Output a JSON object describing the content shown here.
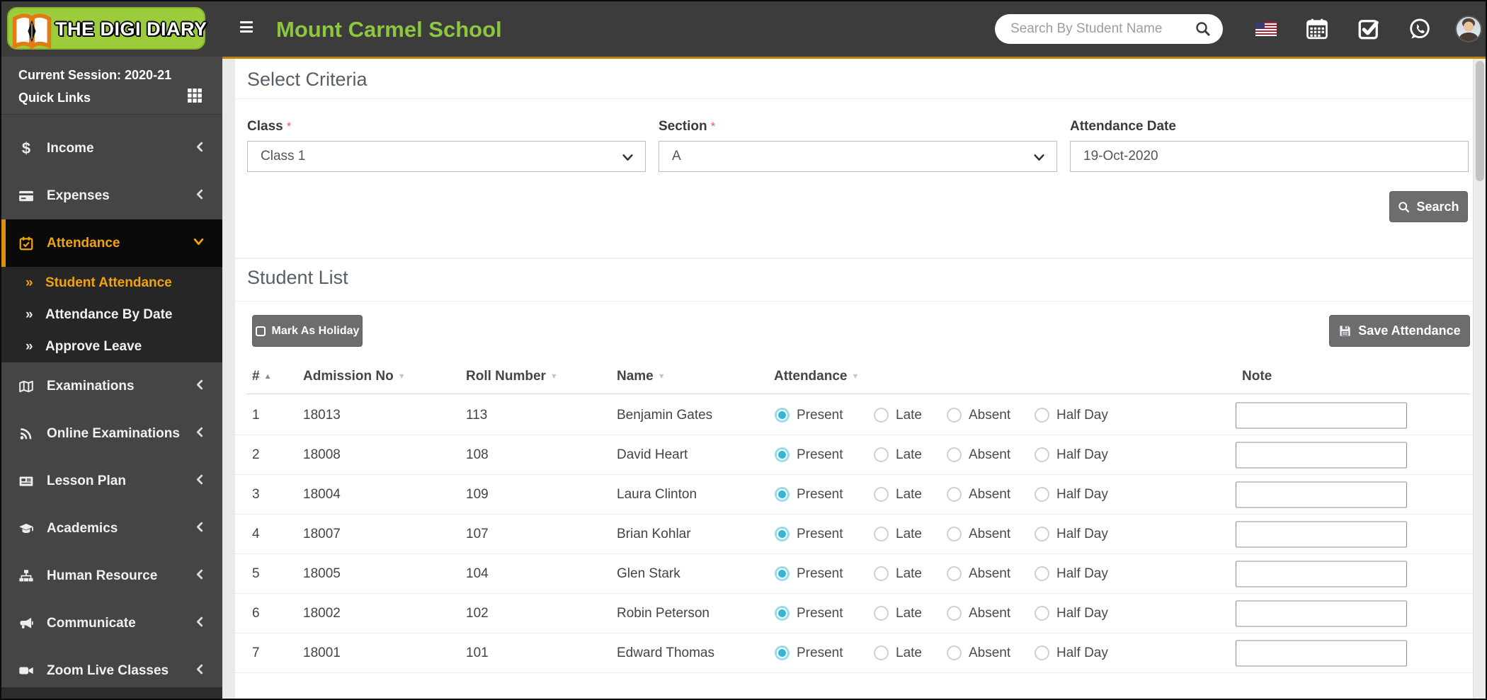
{
  "app": {
    "logo_text": "THE DIGI DIARY",
    "school_name": "Mount Carmel School"
  },
  "header": {
    "search_placeholder": "Search By Student Name"
  },
  "icons": {
    "submenu_arrow": "»",
    "sort_asc": "▲",
    "sort_desc": "▼"
  },
  "colors": {
    "brand_green": "#8dc63f",
    "logo_green": "#9ccb3b",
    "accent_orange": "#f2a20b",
    "radio_selected": "#35b6d6",
    "header_gray": "#3c3c3c",
    "button_gray": "#6d6d6d"
  },
  "sidebar": {
    "session_label": "Current Session: 2020-21",
    "quick_links_label": "Quick Links",
    "items": [
      {
        "label": "Income",
        "icon": "dollar-icon"
      },
      {
        "label": "Expenses",
        "icon": "credit-card-icon"
      },
      {
        "label": "Attendance",
        "icon": "calendar-check-icon",
        "active": true,
        "children": [
          {
            "label": "Student Attendance",
            "active": true
          },
          {
            "label": "Attendance By Date"
          },
          {
            "label": "Approve Leave"
          }
        ]
      },
      {
        "label": "Examinations",
        "icon": "map-icon"
      },
      {
        "label": "Online Examinations",
        "icon": "rss-icon"
      },
      {
        "label": "Lesson Plan",
        "icon": "newspaper-icon"
      },
      {
        "label": "Academics",
        "icon": "graduation-cap-icon"
      },
      {
        "label": "Human Resource",
        "icon": "sitemap-icon"
      },
      {
        "label": "Communicate",
        "icon": "bullhorn-icon"
      },
      {
        "label": "Zoom Live Classes",
        "icon": "video-icon"
      }
    ]
  },
  "criteria": {
    "title": "Select Criteria",
    "required_marker": "*",
    "class_label": "Class",
    "class_value": "Class 1",
    "section_label": "Section",
    "section_value": "A",
    "date_label": "Attendance Date",
    "date_value": "19-Oct-2020",
    "search_button": "Search"
  },
  "student_list": {
    "title": "Student List",
    "mark_holiday_button": "Mark As Holiday",
    "save_button": "Save Attendance",
    "columns": {
      "sn": "#",
      "admission": "Admission No",
      "roll": "Roll Number",
      "name": "Name",
      "attendance": "Attendance",
      "note": "Note"
    },
    "attendance_options": [
      "Present",
      "Late",
      "Absent",
      "Half Day"
    ],
    "rows": [
      {
        "sn": "1",
        "admission_no": "18013",
        "roll_number": "113",
        "name": "Benjamin Gates",
        "attendance": "Present",
        "note": ""
      },
      {
        "sn": "2",
        "admission_no": "18008",
        "roll_number": "108",
        "name": "David Heart",
        "attendance": "Present",
        "note": ""
      },
      {
        "sn": "3",
        "admission_no": "18004",
        "roll_number": "109",
        "name": "Laura Clinton",
        "attendance": "Present",
        "note": ""
      },
      {
        "sn": "4",
        "admission_no": "18007",
        "roll_number": "107",
        "name": "Brian Kohlar",
        "attendance": "Present",
        "note": ""
      },
      {
        "sn": "5",
        "admission_no": "18005",
        "roll_number": "104",
        "name": "Glen Stark",
        "attendance": "Present",
        "note": ""
      },
      {
        "sn": "6",
        "admission_no": "18002",
        "roll_number": "102",
        "name": "Robin Peterson",
        "attendance": "Present",
        "note": ""
      },
      {
        "sn": "7",
        "admission_no": "18001",
        "roll_number": "101",
        "name": "Edward Thomas",
        "attendance": "Present",
        "note": ""
      }
    ]
  }
}
